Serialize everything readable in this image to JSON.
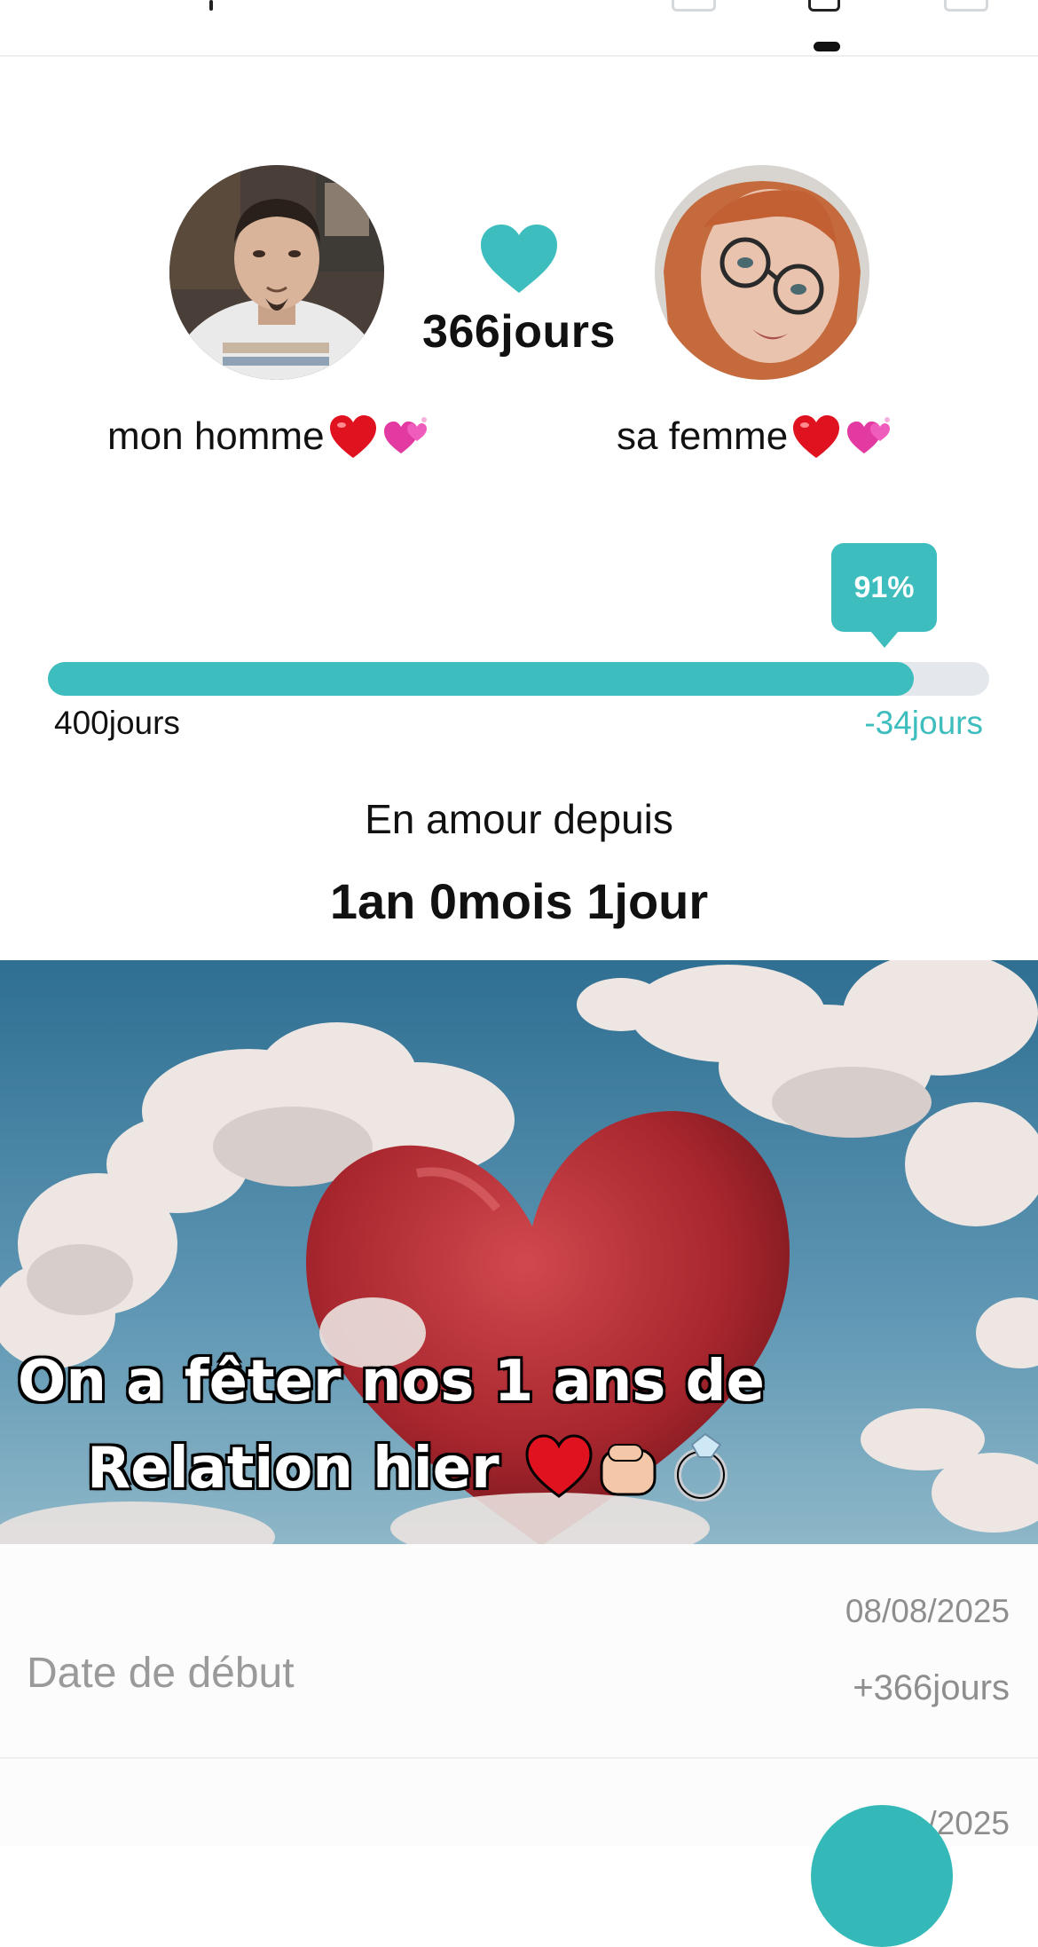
{
  "colors": {
    "accent": "#3dbdbd",
    "track": "#e4e8ec",
    "muted": "#8e8e8e"
  },
  "header": {
    "icons": [
      "menu-icon",
      "calendar-icon",
      "gift-icon",
      "book-icon"
    ],
    "active_tab": "gift-icon"
  },
  "couple": {
    "days_together": "366jours",
    "left_name": "mon homme",
    "right_name": "sa femme",
    "name_emojis": [
      "red-heart",
      "sparkling-hearts"
    ]
  },
  "progress": {
    "percent_label": "91%",
    "fraction": 0.92,
    "goal_label": "400jours",
    "remaining_label": "-34jours"
  },
  "since": {
    "label": "En amour depuis",
    "value": "1an 0mois 1jour"
  },
  "photo": {
    "caption_line1": "On a fêter nos 1 ans de",
    "caption_line2": "Relation hier"
  },
  "events": [
    {
      "label": "Date de début",
      "date": "08/08/2025",
      "extra": "+366jours"
    },
    {
      "date": "/2025"
    }
  ]
}
